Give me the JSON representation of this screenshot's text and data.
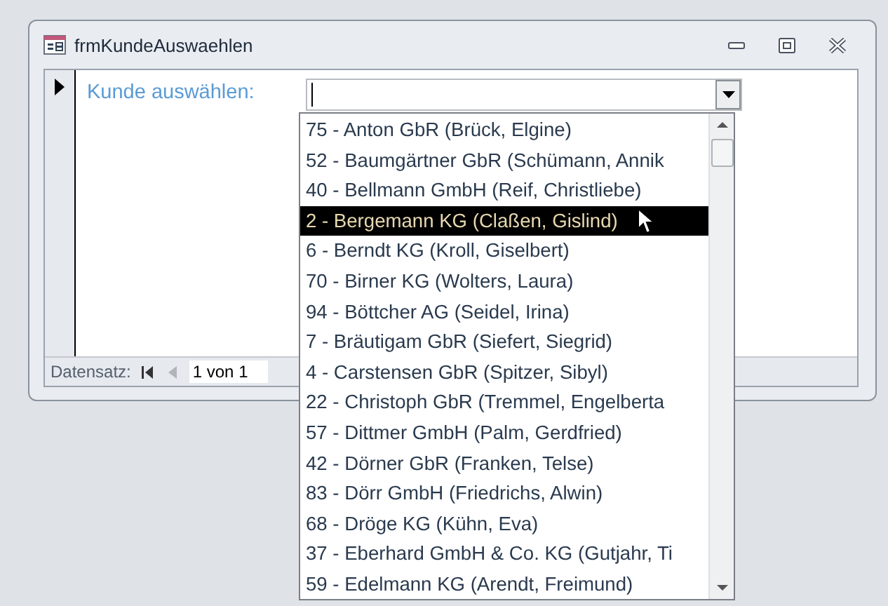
{
  "window": {
    "title": "frmKundeAuswaehlen"
  },
  "form": {
    "label": "Kunde auswählen:"
  },
  "dropdown": {
    "items": [
      {
        "text": "75 - Anton GbR (Brück, Elgine)",
        "selected": false
      },
      {
        "text": "52 - Baumgärtner GbR (Schümann, Annik",
        "selected": false
      },
      {
        "text": "40 - Bellmann GmbH (Reif, Christliebe)",
        "selected": false
      },
      {
        "text": "2 - Bergemann KG (Claßen, Gislind)",
        "selected": true
      },
      {
        "text": "6 - Berndt KG (Kroll, Giselbert)",
        "selected": false
      },
      {
        "text": "70 - Birner KG (Wolters, Laura)",
        "selected": false
      },
      {
        "text": "94 - Böttcher AG (Seidel, Irina)",
        "selected": false
      },
      {
        "text": "7 - Bräutigam GbR (Siefert, Siegrid)",
        "selected": false
      },
      {
        "text": "4 - Carstensen GbR (Spitzer, Sibyl)",
        "selected": false
      },
      {
        "text": "22 - Christoph GbR (Tremmel, Engelberta",
        "selected": false
      },
      {
        "text": "57 - Dittmer GmbH (Palm, Gerdfried)",
        "selected": false
      },
      {
        "text": "42 - Dörner GbR (Franken, Telse)",
        "selected": false
      },
      {
        "text": "83 - Dörr GmbH (Friedrichs, Alwin)",
        "selected": false
      },
      {
        "text": "68 - Dröge KG (Kühn, Eva)",
        "selected": false
      },
      {
        "text": "37 - Eberhard GmbH & Co. KG (Gutjahr, Ti",
        "selected": false
      },
      {
        "text": "59 - Edelmann KG (Arendt, Freimund)",
        "selected": false
      }
    ]
  },
  "navigation": {
    "label": "Datensatz:",
    "position": "1 von 1"
  }
}
